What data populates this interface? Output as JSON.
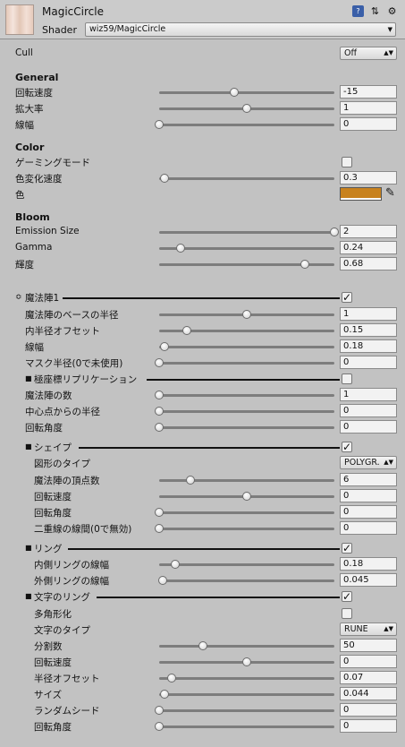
{
  "header": {
    "title": "MagicCircle",
    "shader_label": "Shader",
    "shader_value": "wiz59/MagicCircle"
  },
  "cull": {
    "label": "Cull",
    "value": "Off"
  },
  "general": {
    "title": "General",
    "rotation_speed": {
      "label": "回転速度",
      "value": "-15",
      "level": 0.43
    },
    "scale": {
      "label": "拡大率",
      "value": "1",
      "level": 0.5
    },
    "line_width": {
      "label": "線幅",
      "value": "0",
      "level": 0.0
    }
  },
  "color": {
    "title": "Color",
    "gaming_mode": {
      "label": "ゲーミングモード",
      "checked": false
    },
    "hue_speed": {
      "label": "色変化速度",
      "value": "0.3",
      "level": 0.03
    },
    "color": {
      "label": "色",
      "swatch": "#c8821e"
    }
  },
  "bloom": {
    "title": "Bloom",
    "emission": {
      "label": "Emission Size",
      "value": "2",
      "level": 1.0
    },
    "gamma": {
      "label": "Gamma",
      "value": "0.24",
      "level": 0.12
    },
    "brightness": {
      "label": "輝度",
      "value": "0.68",
      "level": 0.83
    }
  },
  "circle1": {
    "title": "魔法陣1",
    "checked": true,
    "base_radius": {
      "label": "魔法陣のベースの半径",
      "value": "1",
      "level": 0.5
    },
    "inner_offset": {
      "label": "内半径オフセット",
      "value": "0.15",
      "level": 0.16
    },
    "line_width": {
      "label": "線幅",
      "value": "0.18",
      "level": 0.03
    },
    "mask_radius": {
      "label": "マスク半径(0で未使用)",
      "value": "0",
      "level": 0.0
    },
    "polar": {
      "title": "極座標リプリケーション",
      "checked": false,
      "count": {
        "label": "魔法陣の数",
        "value": "1",
        "level": 0.0
      },
      "center_radius": {
        "label": "中心点からの半径",
        "value": "0",
        "level": 0.0
      },
      "rotation": {
        "label": "回転角度",
        "value": "0",
        "level": 0.0
      }
    },
    "shape": {
      "title": "シェイプ",
      "checked": true,
      "type": {
        "label": "図形のタイプ",
        "value": "POLYGR."
      },
      "vertices": {
        "label": "魔法陣の頂点数",
        "value": "6",
        "level": 0.18
      },
      "rotation_speed": {
        "label": "回転速度",
        "value": "0",
        "level": 0.5
      },
      "rotation": {
        "label": "回転角度",
        "value": "0",
        "level": 0.0
      },
      "double_gap": {
        "label": "二重線の線間(0で無効)",
        "value": "0",
        "level": 0.0
      }
    },
    "ring": {
      "title": "リング",
      "checked": true,
      "inner": {
        "label": "内側リングの線幅",
        "value": "0.18",
        "level": 0.09
      },
      "outer": {
        "label": "外側リングの線幅",
        "value": "0.045",
        "level": 0.02
      }
    },
    "text_ring": {
      "title": "文字のリング",
      "checked": true,
      "polygonize": {
        "label": "多角形化",
        "checked": false
      },
      "char_type": {
        "label": "文字のタイプ",
        "value": "RUNE"
      },
      "divisions": {
        "label": "分割数",
        "value": "50",
        "level": 0.25
      },
      "rotation_speed": {
        "label": "回転速度",
        "value": "0",
        "level": 0.5
      },
      "radius_offset": {
        "label": "半径オフセット",
        "value": "0.07",
        "level": 0.07
      },
      "size": {
        "label": "サイズ",
        "value": "0.044",
        "level": 0.03
      },
      "random_seed": {
        "label": "ランダムシード",
        "value": "0",
        "level": 0.0
      },
      "rotation": {
        "label": "回転角度",
        "value": "0",
        "level": 0.0
      }
    }
  }
}
